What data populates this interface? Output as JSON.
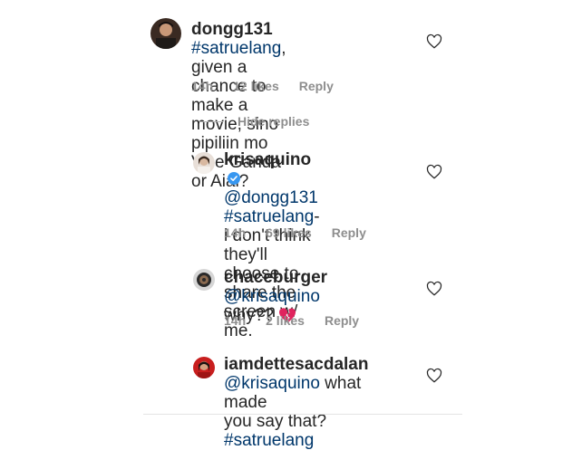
{
  "comments": [
    {
      "username": "dongg131",
      "parts": [
        {
          "t": "hashtag",
          "v": "#satruelang"
        },
        {
          "t": "text",
          "v": ", given a"
        }
      ],
      "line2": "chance to make a movie, sino",
      "line3": "pipiliin mo Vice Ganda or Aiai?",
      "time": "14h",
      "likes": "12 likes",
      "reply": "Reply"
    },
    {
      "username": "krisaquino",
      "mention": "@dongg131",
      "hashtag": "#satruelang",
      "rest1": "- i don't think",
      "line3": "they'll choose to share the",
      "line4": "screen w/ me.",
      "time": "14h",
      "likes": "69 likes",
      "reply": "Reply"
    },
    {
      "username": "chaceburger",
      "mention": "@krisaquino",
      "line2": "why??",
      "time": "14h",
      "likes": "2 likes",
      "reply": "Reply"
    },
    {
      "username": "iamdettesacdalan",
      "mention": "@krisaquino",
      "text": " what made",
      "line3_text": "you say that? ",
      "hashtag": "#satruelang"
    }
  ],
  "hide_replies": "Hide replies",
  "icons": {
    "heart": "heart-outline-icon",
    "verified": "verified-badge-icon",
    "broken_heart": "broken-heart-emoji"
  },
  "colors": {
    "text": "#262626",
    "link": "#00376b",
    "muted": "#8e8e8e",
    "verified": "#3897f0",
    "broken_heart": "#e0245e"
  }
}
